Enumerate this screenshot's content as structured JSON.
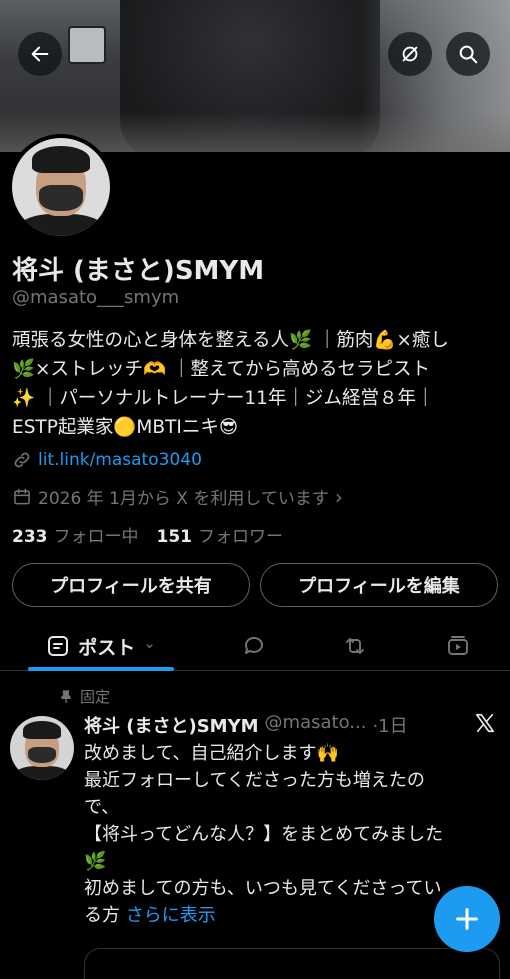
{
  "profile": {
    "name": "将斗 (まさと)SMYM",
    "handle": "@masato___smym",
    "bio_lines": [
      "頑張る女性の心と身体を整える人🌿 ｜筋肉💪×癒し",
      "🌿×ストレッチ🫶 ｜整えてから高めるセラピスト",
      "✨ ｜パーソナルトレーナー11年｜ジム経営８年｜",
      "ESTP起業家🟡MBTIニキ😎"
    ],
    "link": "lit.link/masato3040",
    "joined": "2026 年 1月から X を利用しています",
    "joined_chevron": "›",
    "following_count": "233",
    "following_label": "フォロー中",
    "followers_count": "151",
    "followers_label": "フォロワー"
  },
  "buttons": {
    "share": "プロフィールを共有",
    "edit": "プロフィールを編集"
  },
  "tabs": {
    "posts_label": "ポスト",
    "posts_chevron": "⌄"
  },
  "post": {
    "pinned_label": "固定",
    "author_name": "将斗 (まさと)SMYM",
    "author_handle": "@masato...",
    "time": "·1日",
    "lines": [
      "改めまして、自己紹介します🙌",
      "最近フォローしてくださった方も増えたの",
      "で、",
      "【将斗ってどんな人？】をまとめてみました",
      "🌿",
      "初めましての方も、いつも見てくださってい",
      "る方"
    ],
    "show_more": "さらに表示"
  },
  "colors": {
    "accent": "#1d9bf0",
    "background": "#000000",
    "text": "#e7e9ea",
    "muted": "#71767b"
  },
  "icons": [
    "back-arrow-icon",
    "refresh-off-icon",
    "search-icon",
    "link-icon",
    "calendar-icon",
    "list-icon",
    "reply-icon",
    "retweet-icon",
    "media-icon",
    "pin-icon",
    "x-logo-icon",
    "plus-icon"
  ]
}
